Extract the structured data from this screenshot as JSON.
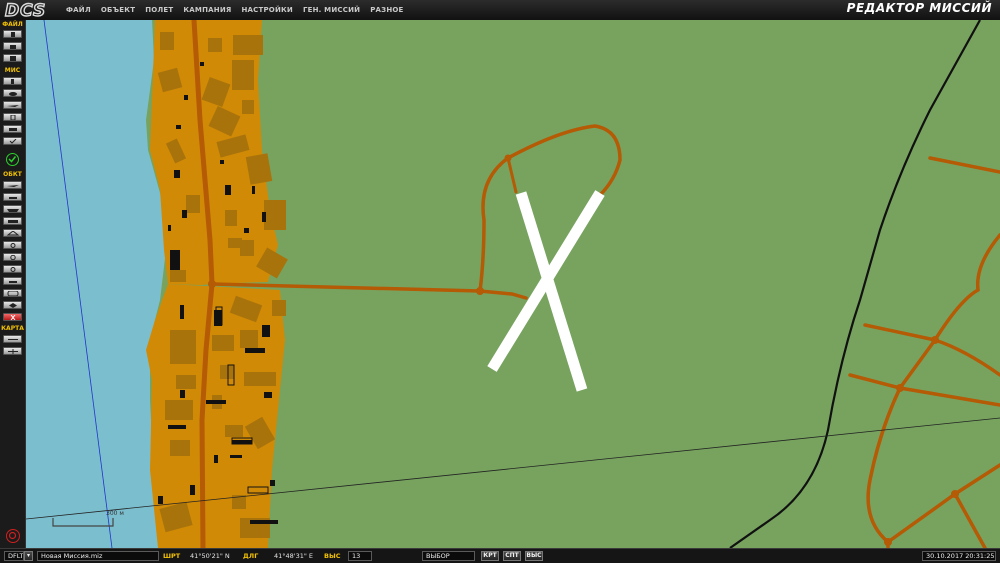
{
  "app": {
    "logo_text": "DCS",
    "title": "РЕДАКТОР МИССИЙ"
  },
  "menu": [
    "ФАЙЛ",
    "ОБЪЕКТ",
    "ПОЛЕТ",
    "КАМПАНИЯ",
    "НАСТРОЙКИ",
    "ГЕН. МИССИЙ",
    "РАЗНОЕ"
  ],
  "sidebar": {
    "file_label": "ФАЙЛ",
    "mission_label": "МИС",
    "objects_label": "ОБКТ",
    "map_label": "КАРТА"
  },
  "map": {
    "scale_label": "300 м",
    "colors": {
      "water": "#7bbfcf",
      "land": "#77a35f",
      "town": "#d18a06",
      "road": "#b55a05",
      "building": "#a9730c",
      "runway": "#ffffff"
    }
  },
  "status": {
    "coalition": "DFLT",
    "mission_name": "Новая Миссия.miz",
    "lat_label": "ШРТ",
    "lat_value": "41°50'21\" N",
    "lon_label": "ДЛГ",
    "lon_value": "41°48'31\" E",
    "alt_label": "ВЫС",
    "alt_value": "13",
    "select_value": "ВЫБОР",
    "buttons": [
      "КРТ",
      "СПТ",
      "ВЫС"
    ],
    "datetime": "30.10.2017 20:31:25"
  }
}
